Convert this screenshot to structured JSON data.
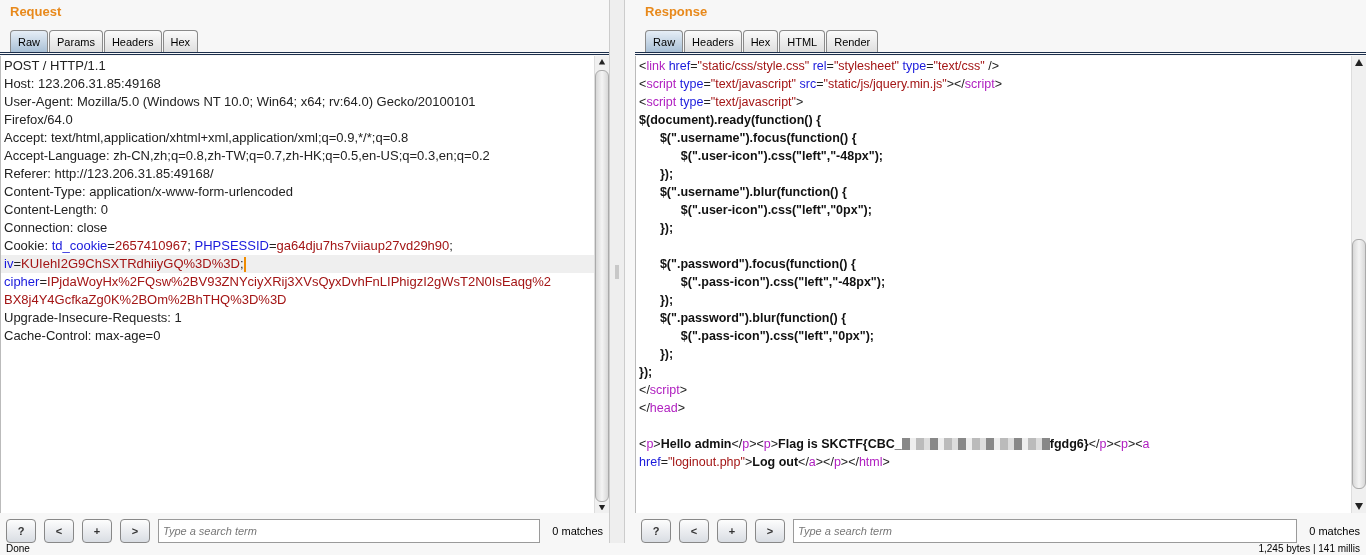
{
  "request": {
    "title": "Request",
    "tabs": [
      {
        "label": "Raw",
        "selected": true
      },
      {
        "label": "Params",
        "selected": false
      },
      {
        "label": "Headers",
        "selected": false
      },
      {
        "label": "Hex",
        "selected": false
      }
    ],
    "lines": [
      {
        "current": false,
        "segments": [
          {
            "text": "POST / HTTP/1.1"
          }
        ]
      },
      {
        "current": false,
        "segments": [
          {
            "text": "Host: 123.206.31.85:49168"
          }
        ]
      },
      {
        "current": false,
        "segments": [
          {
            "text": "User-Agent: Mozilla/5.0 (Windows NT 10.0; Win64; x64; rv:64.0) Gecko/20100101"
          }
        ]
      },
      {
        "current": false,
        "segments": [
          {
            "text": "Firefox/64.0"
          }
        ]
      },
      {
        "current": false,
        "segments": [
          {
            "text": "Accept: text/html,application/xhtml+xml,application/xml;q=0.9,*/*;q=0.8"
          }
        ]
      },
      {
        "current": false,
        "segments": [
          {
            "text": "Accept-Language: zh-CN,zh;q=0.8,zh-TW;q=0.7,zh-HK;q=0.5,en-US;q=0.3,en;q=0.2"
          }
        ]
      },
      {
        "current": false,
        "segments": [
          {
            "text": "Referer: http://123.206.31.85:49168/"
          }
        ]
      },
      {
        "current": false,
        "segments": [
          {
            "text": "Content-Type: application/x-www-form-urlencoded"
          }
        ]
      },
      {
        "current": false,
        "segments": [
          {
            "text": "Content-Length: 0"
          }
        ]
      },
      {
        "current": false,
        "segments": [
          {
            "text": "Connection: close"
          }
        ]
      },
      {
        "current": false,
        "segments": [
          {
            "text": "Cookie:"
          },
          {
            "attr": "td_cookie"
          },
          {
            "text": "="
          },
          {
            "value": "2657410967"
          },
          {
            "text": ";"
          },
          {
            "attr": "PHPSESSID"
          },
          {
            "text": "="
          },
          {
            "value": "ga64dju7hs7viiaup27vd29h90"
          },
          {
            "text": ";"
          }
        ]
      },
      {
        "current": true,
        "segments": [
          {
            "attr": "iv"
          },
          {
            "text": "="
          },
          {
            "value": "KUIehI2G9ChSXTRdhiiyGQ%3D%3D"
          },
          {
            "text": ";"
          }
        ]
      },
      {
        "current": false,
        "segments": [
          {
            "attr": "cipher"
          },
          {
            "text": "="
          },
          {
            "value": "IPjdaWoyHx%2FQsw%2BV93ZNYciyXRij3XVsQyxDvhFnLIPhigzI2gWsT2N0IsEaqg%2"
          }
        ]
      },
      {
        "current": false,
        "segments": [
          {
            "value": "BX8j4Y4GcfkaZg0K%2BOm%2BhTHQ%3D%3D"
          }
        ]
      },
      {
        "current": false,
        "segments": [
          {
            "text": "Upgrade-Insecure-Requests: 1"
          }
        ]
      },
      {
        "current": false,
        "segments": [
          {
            "text": "Cache-Control: max-age=0"
          }
        ]
      }
    ],
    "search": {
      "buttons": [
        "?",
        "<",
        "+",
        ">"
      ],
      "placeholder": "Type a search term",
      "matches": "0 matches"
    }
  },
  "response": {
    "title": "Response",
    "tabs": [
      {
        "label": "Raw",
        "selected": true
      },
      {
        "label": "Headers",
        "selected": false
      },
      {
        "label": "Hex",
        "selected": false
      },
      {
        "label": "HTML",
        "selected": false
      },
      {
        "label": "Render",
        "selected": false
      }
    ],
    "lines": [
      {
        "segments": [
          {
            "text": "<"
          },
          {
            "tag": "link"
          },
          {
            "attr": "href"
          },
          {
            "text": "="
          },
          {
            "value": "\"static/css/style.css\""
          },
          {
            "attr": "rel"
          },
          {
            "text": "="
          },
          {
            "value": "\"stylesheet\""
          },
          {
            "attr": "type"
          },
          {
            "text": "="
          },
          {
            "value": "\"text/css\""
          },
          {
            "text": " />"
          }
        ]
      },
      {
        "segments": [
          {
            "text": "<"
          },
          {
            "tag": "script"
          },
          {
            "attr": "type"
          },
          {
            "text": "="
          },
          {
            "value": "\"text/javascript\""
          },
          {
            "attr": "src"
          },
          {
            "text": "="
          },
          {
            "value": "\"static/js/jquery.min.js\""
          },
          {
            "text": "></"
          },
          {
            "tag": "script"
          },
          {
            "text": ">"
          }
        ]
      },
      {
        "segments": [
          {
            "text": "<"
          },
          {
            "tag": "script"
          },
          {
            "attr": "type"
          },
          {
            "text": "="
          },
          {
            "value": "\"text/javascript\""
          },
          {
            "text": ">"
          }
        ]
      },
      {
        "segments": [
          {
            "bold": "$(document).ready(function() {"
          }
        ]
      },
      {
        "segments": [
          {
            "bold": "\t$(\".username\").focus(function() {"
          }
        ]
      },
      {
        "segments": [
          {
            "bold": "\t\t$(\".user-icon\").css(\"left\",\"-48px\");"
          }
        ]
      },
      {
        "segments": [
          {
            "bold": "\t});"
          }
        ]
      },
      {
        "segments": [
          {
            "bold": "\t$(\".username\").blur(function() {"
          }
        ]
      },
      {
        "segments": [
          {
            "bold": "\t\t$(\".user-icon\").css(\"left\",\"0px\");"
          }
        ]
      },
      {
        "segments": [
          {
            "bold": "\t});"
          }
        ]
      },
      {
        "blank": true
      },
      {
        "segments": [
          {
            "bold": "\t$(\".password\").focus(function() {"
          }
        ]
      },
      {
        "segments": [
          {
            "bold": "\t\t$(\".pass-icon\").css(\"left\",\"-48px\");"
          }
        ]
      },
      {
        "segments": [
          {
            "bold": "\t});"
          }
        ]
      },
      {
        "segments": [
          {
            "bold": "\t$(\".password\").blur(function() {"
          }
        ]
      },
      {
        "segments": [
          {
            "bold": "\t\t$(\".pass-icon\").css(\"left\",\"0px\");"
          }
        ]
      },
      {
        "segments": [
          {
            "bold": "\t});"
          }
        ]
      },
      {
        "segments": [
          {
            "bold": "});"
          }
        ]
      },
      {
        "segments": [
          {
            "text": "</"
          },
          {
            "tag": "script"
          },
          {
            "text": ">"
          }
        ]
      },
      {
        "segments": [
          {
            "text": "</"
          },
          {
            "tag": "head"
          },
          {
            "text": ">"
          }
        ]
      },
      {
        "blank": true
      },
      {
        "segments": [
          {
            "text": "<"
          },
          {
            "tag": "p"
          },
          {
            "text": ">"
          },
          {
            "bold": "Hello admin"
          },
          {
            "text": "</"
          },
          {
            "tag": "p"
          },
          {
            "text": "><"
          },
          {
            "tag": "p"
          },
          {
            "text": ">"
          },
          {
            "bold": "Flag is SKCTF{CBC_"
          },
          {
            "redacted": true
          },
          {
            "bold": "fgdg6}"
          },
          {
            "text": "</"
          },
          {
            "tag": "p"
          },
          {
            "text": "><"
          },
          {
            "tag": "p"
          },
          {
            "text": "><"
          },
          {
            "tag": "a"
          }
        ]
      },
      {
        "segments": [
          {
            "attr": "href"
          },
          {
            "text": "="
          },
          {
            "value": "\"loginout.php\""
          },
          {
            "text": ">"
          },
          {
            "bold": "Log out"
          },
          {
            "text": "</"
          },
          {
            "tag": "a"
          },
          {
            "text": "></"
          },
          {
            "tag": "p"
          },
          {
            "text": "></"
          },
          {
            "tag": "html"
          },
          {
            "text": ">"
          }
        ]
      }
    ],
    "search": {
      "buttons": [
        "?",
        "<",
        "+",
        ">"
      ],
      "placeholder": "Type a search term",
      "matches": "0 matches"
    }
  },
  "status_bar": {
    "left": "Done",
    "right": "1,245 bytes | 141 millis"
  }
}
